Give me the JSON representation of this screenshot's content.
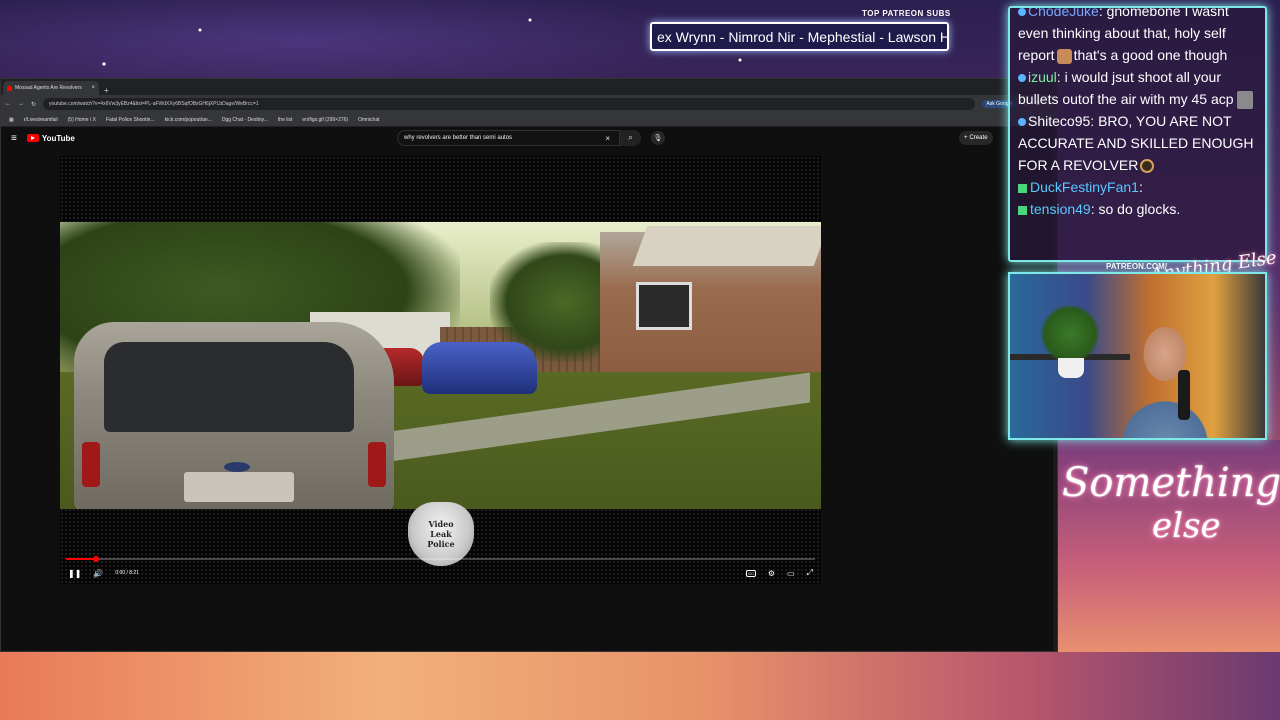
{
  "browser": {
    "tab_title": "Mossad Agents Are Revolvers",
    "url": "youtube.com/watch?v=4x6Vw3yEBz4&list=PL-aFWdXXy6BSqfOBsGH6jXPLbDage/WeBrcc=1",
    "ask_label": "Ask Google",
    "bookmarks": [
      "r/Livestreamfail",
      "(5) Home / X",
      "Fatal Police Shootin...",
      "kick.com/popout/an...",
      "Dgg Chat - Destiny...",
      "the list",
      "en/figs.gif (299×276)",
      "Omnichat"
    ]
  },
  "youtube": {
    "logo_text": "YouTube",
    "search_query": "why revolvers are better than semi autos",
    "create_label": "Create",
    "player": {
      "badge_lines": [
        "Video",
        "Leak",
        "Police"
      ],
      "time": "0:00 / 8:21",
      "progress_fraction": 0.04
    }
  },
  "overlay": {
    "patreon_title": "TOP PATREON SUBS",
    "patreon_names": "ex Wrynn - Nimrod Nir - Mephestial - Lawson H",
    "patreon_url": "PATREON.COM/",
    "anything_else": "Anything Else",
    "brand_line1": "Something",
    "brand_line2": "else"
  },
  "chat": {
    "messages": [
      {
        "user": "ChodeJuke",
        "text": "gnomebone I wasnt even thinking about that, holy self report",
        "tail": "that's a good one though"
      },
      {
        "user": "izuul",
        "text": "i would jsut shoot all your bullets outof the air with my 45 acp"
      },
      {
        "user": "Shiteco95",
        "text": "BRO, YOU ARE NOT ACCURATE AND SKILLED ENOUGH FOR A REVOLVER"
      },
      {
        "user": "DuckFestinyFan1",
        "text": ""
      },
      {
        "user": "tension49",
        "text": "so do glocks."
      }
    ]
  },
  "colors": {
    "accent_cyan": "#7fe8e8",
    "youtube_red": "#ff0000"
  }
}
